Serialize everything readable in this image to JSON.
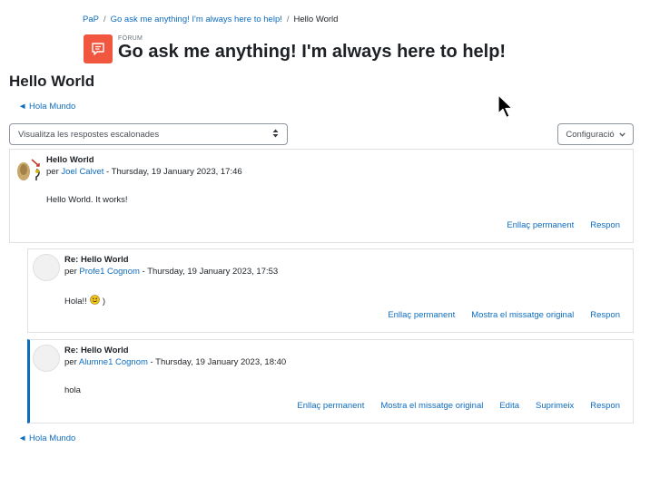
{
  "breadcrumb": {
    "items": [
      "PaP",
      "Go ask me anything! I'm always here to help!"
    ],
    "current": "Hello World"
  },
  "forum": {
    "kicker": "FÒRUM",
    "title": "Go ask me anything! I'm always here to help!",
    "icon": "forum-icon",
    "icon_color": "#f0573e"
  },
  "page_title": "Hello World",
  "nav": {
    "back_label": "◄ Hola Mundo",
    "bottom_label": "◄ Hola Mundo"
  },
  "display_mode": {
    "selected": "Visualitza les respostes escalonades"
  },
  "settings": {
    "label": "Configuració"
  },
  "posts": [
    {
      "subject": "Hello World",
      "by": "per",
      "author": "Joel Calvet",
      "date": " - Thursday, 19 January 2023, 17:46",
      "body": "Hello World. It works!",
      "actions": [
        "Enllaç permanent",
        "Respon"
      ]
    },
    {
      "subject": "Re: Hello World",
      "by": "per",
      "author": "Profe1 Cognom",
      "date": " - Thursday, 19 January 2023, 17:53",
      "body": "Hola!!",
      "body_suffix": ")",
      "actions": [
        "Enllaç permanent",
        "Mostra el missatge original",
        "Respon"
      ]
    },
    {
      "subject": "Re: Hello World",
      "by": "per",
      "author": "Alumne1 Cognom",
      "date": " - Thursday, 19 January 2023, 18:40",
      "body": "hola",
      "actions": [
        "Enllaç permanent",
        "Mostra el missatge original",
        "Edita",
        "Suprimeix",
        "Respon"
      ]
    }
  ],
  "colors": {
    "link": "#0f6cbf",
    "accent_border": "#0f6cbf",
    "text": "#1d2125"
  }
}
